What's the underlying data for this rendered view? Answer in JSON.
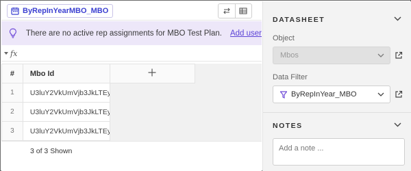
{
  "sheet_tab": {
    "label": "ByRepInYearMBO_MBO",
    "icon": "calendar-icon"
  },
  "toolbar": {
    "icons": [
      "swap-icon",
      "table-icon"
    ]
  },
  "banner": {
    "message": "There are no active rep assignments for MBO Test Plan.",
    "link": "Add user",
    "icon": "lightbulb-icon",
    "bg": "#ede7f9",
    "accent": "#5b43d6"
  },
  "formula": {
    "symbol": "fx"
  },
  "grid": {
    "headers": {
      "num": "#",
      "id": "Mbo Id",
      "add": "+"
    },
    "rows": [
      {
        "num": "1",
        "id": "U3luY2VkUmVjb3JkLTEy"
      },
      {
        "num": "2",
        "id": "U3luY2VkUmVjb3JkLTEy"
      },
      {
        "num": "3",
        "id": "U3luY2VkUmVjb3JkLTEy"
      }
    ],
    "footer": "3 of 3 Shown"
  },
  "datasheet": {
    "title": "DATASHEET",
    "object_label": "Object",
    "object_value": "Mbos",
    "filter_label": "Data Filter",
    "filter_value": "ByRepInYear_MBO",
    "filter_icon_color": "#6f4bd8"
  },
  "notes": {
    "title": "NOTES",
    "placeholder": "Add a note ..."
  }
}
